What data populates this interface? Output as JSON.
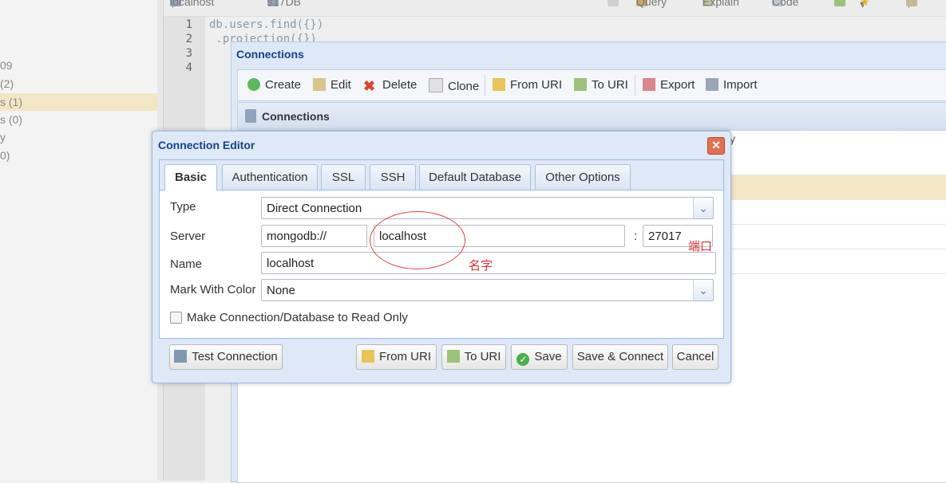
{
  "sidebar": {
    "rows": [
      "09",
      "(2)",
      "s (1)",
      "s (0)",
      "y",
      "0)"
    ]
  },
  "topbar": {
    "connection": "localhost",
    "database": "s17DB",
    "query": "Query",
    "explain": "Explain",
    "code": "Code"
  },
  "editor": {
    "line_numbers": [
      "1",
      "2",
      "3",
      "4"
    ],
    "lines": [
      "db.users.find({})",
      " .projection({})"
    ]
  },
  "connections_window": {
    "title": "Connections",
    "toolbar": {
      "create": "Create",
      "edit": "Edit",
      "delete": "Delete",
      "clone": "Clone",
      "from_uri": "From URI",
      "to_uri": "To URI",
      "export": "Export",
      "import": "Import"
    },
    "grid_title": "Connections",
    "hint": "y"
  },
  "dialog": {
    "title": "Connection Editor",
    "tabs": [
      "Basic",
      "Authentication",
      "SSL",
      "SSH",
      "Default Database",
      "Other Options"
    ],
    "form": {
      "type_label": "Type",
      "type_value": "Direct Connection",
      "server_label": "Server",
      "protocol_value": "mongodb://",
      "host_value": "localhost",
      "port_sep": ":",
      "port_value": "27017",
      "name_label": "Name",
      "name_value": "localhost",
      "color_label": "Mark With Color",
      "color_value": "None",
      "readonly_label": "Make Connection/Database to Read Only"
    },
    "buttons": {
      "test": "Test Connection",
      "from_uri": "From URI",
      "to_uri": "To URI",
      "save": "Save",
      "save_connect": "Save & Connect",
      "cancel": "Cancel"
    }
  },
  "annotations": {
    "port": "端口",
    "name": "名字"
  },
  "colors": {
    "annotation_red": "#e03030",
    "selection": "#f2e6c4",
    "title_blue": "#15428b"
  }
}
